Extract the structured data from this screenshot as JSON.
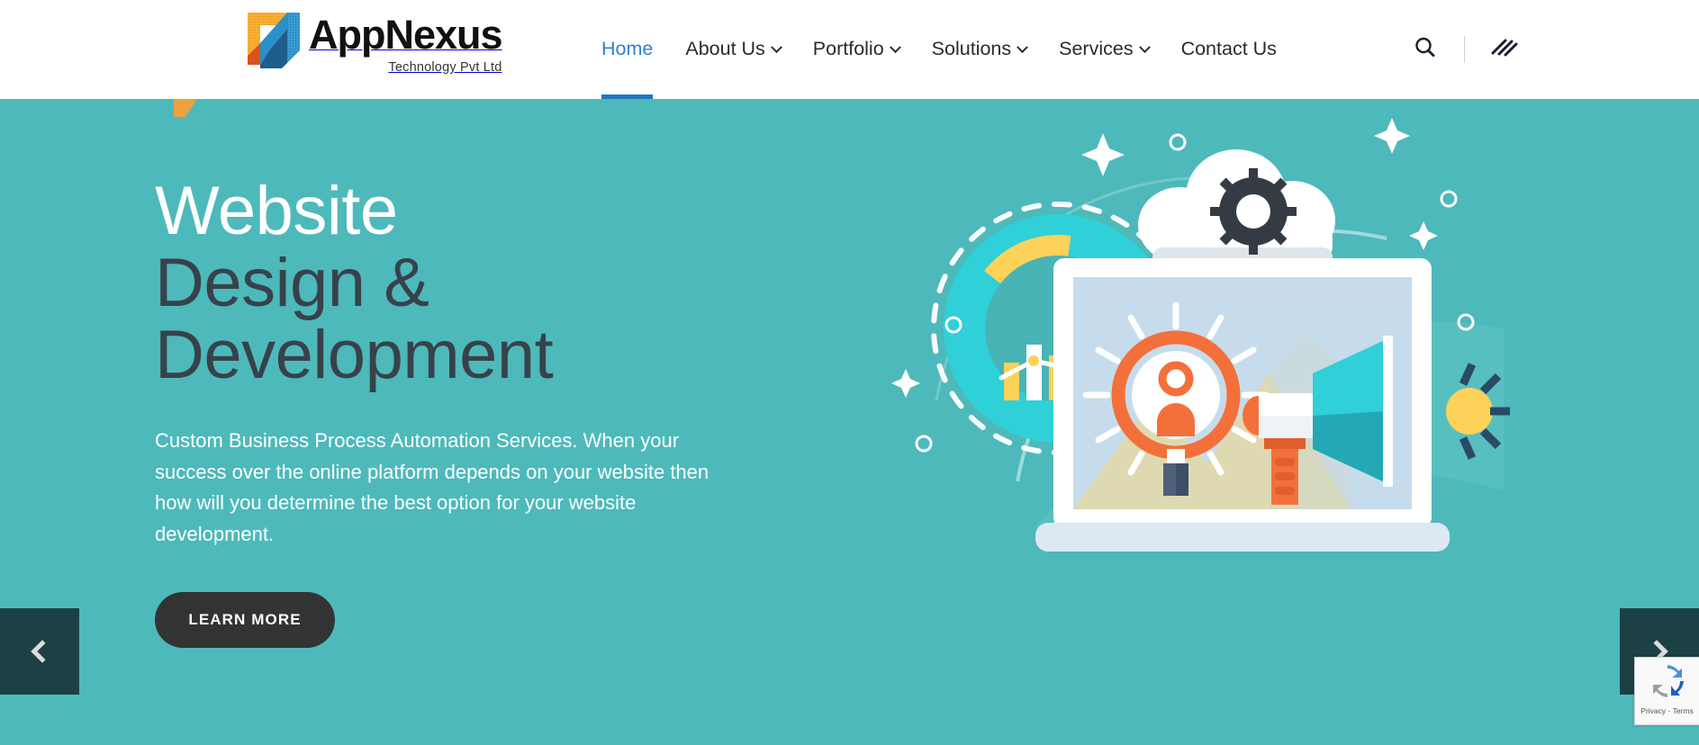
{
  "brand": {
    "name": "AppNexus",
    "tagline": "Technology Pvt Ltd",
    "logo_icon": "appnexus-n-logo",
    "accent_blue": "#2176bd",
    "accent_orange": "#f26c35"
  },
  "nav": {
    "items": [
      {
        "label": "Home",
        "has_dropdown": false,
        "active": true
      },
      {
        "label": "About Us",
        "has_dropdown": true,
        "active": false
      },
      {
        "label": "Portfolio",
        "has_dropdown": true,
        "active": false
      },
      {
        "label": "Solutions",
        "has_dropdown": true,
        "active": false
      },
      {
        "label": "Services",
        "has_dropdown": true,
        "active": false
      },
      {
        "label": "Contact Us",
        "has_dropdown": false,
        "active": false
      }
    ],
    "search_icon": "search-icon",
    "menu_icon": "slanted-hamburger-icon"
  },
  "hero": {
    "heading_line1": "Website",
    "heading_line2": "Design &",
    "heading_line3": "Development",
    "paragraph": "Custom Business Process Automation Services. When your success over the online platform depends on your website then how will you determine the best option for your website development.",
    "cta_label": "LEARN MORE",
    "background_color": "#4db9bb",
    "heading_line1_color": "#ffffff",
    "heading_color": "#37424a",
    "illustration": "website-design-development-illustration"
  },
  "carousel": {
    "prev_icon": "chevron-left-icon",
    "prev_label": "Previous slide",
    "next_icon": "chevron-right-icon",
    "next_label": "Next slide",
    "arrow_background": "#1c4145"
  },
  "recaptcha": {
    "icon": "recaptcha-icon",
    "terms_text": "Privacy - Terms"
  }
}
